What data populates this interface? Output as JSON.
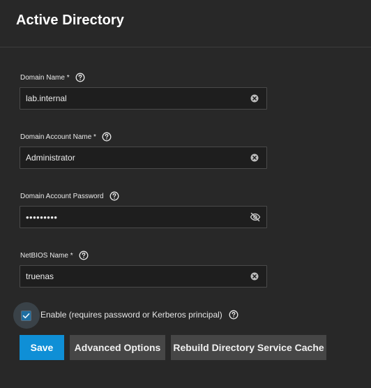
{
  "dialog": {
    "title": "Active Directory"
  },
  "fields": {
    "domain_name": {
      "label": "Domain Name *",
      "value": "lab.internal"
    },
    "account_name": {
      "label": "Domain Account Name *",
      "value": "Administrator"
    },
    "account_password": {
      "label": "Domain Account Password",
      "value": "•••••••••"
    },
    "netbios_name": {
      "label": "NetBIOS Name *",
      "value": "truenas"
    }
  },
  "enable": {
    "label": "Enable (requires password or Kerberos principal)",
    "checked": true
  },
  "buttons": {
    "save": "Save",
    "advanced": "Advanced Options",
    "rebuild": "Rebuild Directory Service Cache"
  },
  "colors": {
    "background": "#282828",
    "input_bg": "#1e1e1e",
    "primary": "#0f8fd6",
    "secondary_button": "#464646",
    "checkbox": "#1d6ea1"
  },
  "icons": {
    "help": "help-circle-icon",
    "clear": "clear-circle-icon",
    "visibility": "eye-off-icon",
    "check": "check-icon"
  }
}
